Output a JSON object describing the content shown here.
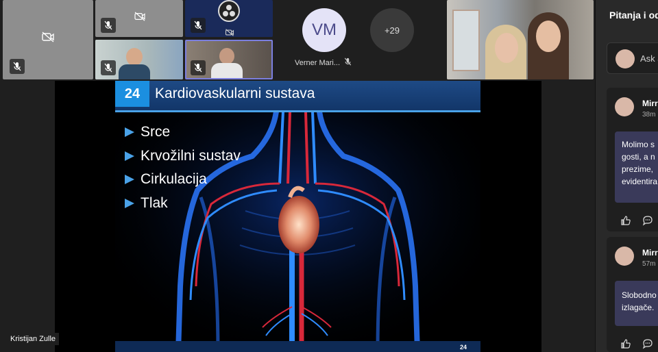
{
  "participants": {
    "verner": {
      "initials": "VM",
      "name": "Verner Mari..."
    },
    "overflow": {
      "label": "+29"
    }
  },
  "presentation": {
    "slide_number": "24",
    "title": "Kardiovaskularni sustava",
    "bullets": [
      "Srce",
      "Krvožilni sustav",
      "Cirkulacija",
      "Tlak"
    ],
    "footer_number": "24",
    "presenter_name": "Kristijan Zulle"
  },
  "qa_panel": {
    "title": "Pitanja i od",
    "ask_placeholder": "Ask a",
    "posts": [
      {
        "author": "Mirr",
        "time": "38m",
        "lines": [
          "Molimo s",
          "gosti, a n",
          "prezime, ",
          "evidentira"
        ]
      },
      {
        "author": "Mirr",
        "time": "57m",
        "lines": [
          "Slobodno",
          "izlagače."
        ]
      }
    ]
  },
  "colors": {
    "accent": "#1b8fe0",
    "slide_header": "#123669",
    "bubble": "#3a3a5a",
    "highlight_border": "#7b7fe0"
  },
  "icons": [
    "camera-off-icon",
    "mic-off-icon",
    "like-icon",
    "reply-icon",
    "obs-logo-icon"
  ]
}
